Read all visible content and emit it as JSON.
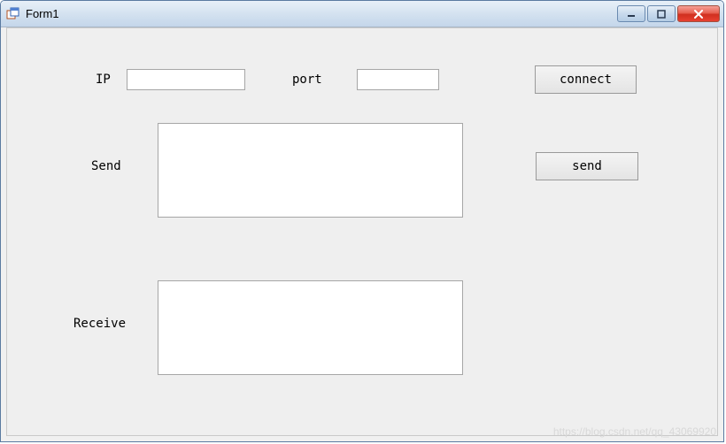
{
  "window": {
    "title": "Form1"
  },
  "labels": {
    "ip": "IP",
    "port": "port",
    "send": "Send",
    "receive": "Receive"
  },
  "inputs": {
    "ip_value": "",
    "port_value": "",
    "send_value": "",
    "receive_value": ""
  },
  "buttons": {
    "connect": "connect",
    "send": "send"
  },
  "watermark": "https://blog.csdn.net/qq_43069920"
}
